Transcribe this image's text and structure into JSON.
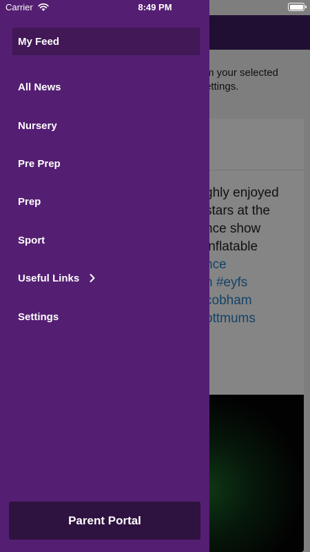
{
  "status_bar": {
    "carrier": "Carrier",
    "time": "8:49 PM",
    "icons": [
      "wifi-icon",
      "battery-icon"
    ]
  },
  "drawer": {
    "menu": [
      {
        "label": "My Feed",
        "active": true
      },
      {
        "label": "All News"
      },
      {
        "label": "Nursery"
      },
      {
        "label": "Pre Prep"
      },
      {
        "label": "Prep"
      },
      {
        "label": "Sport"
      },
      {
        "label": "Useful Links",
        "icon": "chevron-right-icon"
      },
      {
        "label": "Settings"
      }
    ],
    "portal_button": "Parent Portal"
  },
  "background": {
    "intro_text": "m your selected\nettings.",
    "post_lines": [
      "ghly enjoyed",
      "stars at the",
      "nce show",
      "inflatable"
    ],
    "post_tags": [
      "nce",
      "n #eyfs",
      "cobham",
      "ottmums"
    ]
  },
  "colors": {
    "drawer": "#541e72",
    "active_item": "#421857",
    "portal_button": "#2e1240",
    "nav_bar": "#3f1e63",
    "link": "#2a7fc7"
  }
}
